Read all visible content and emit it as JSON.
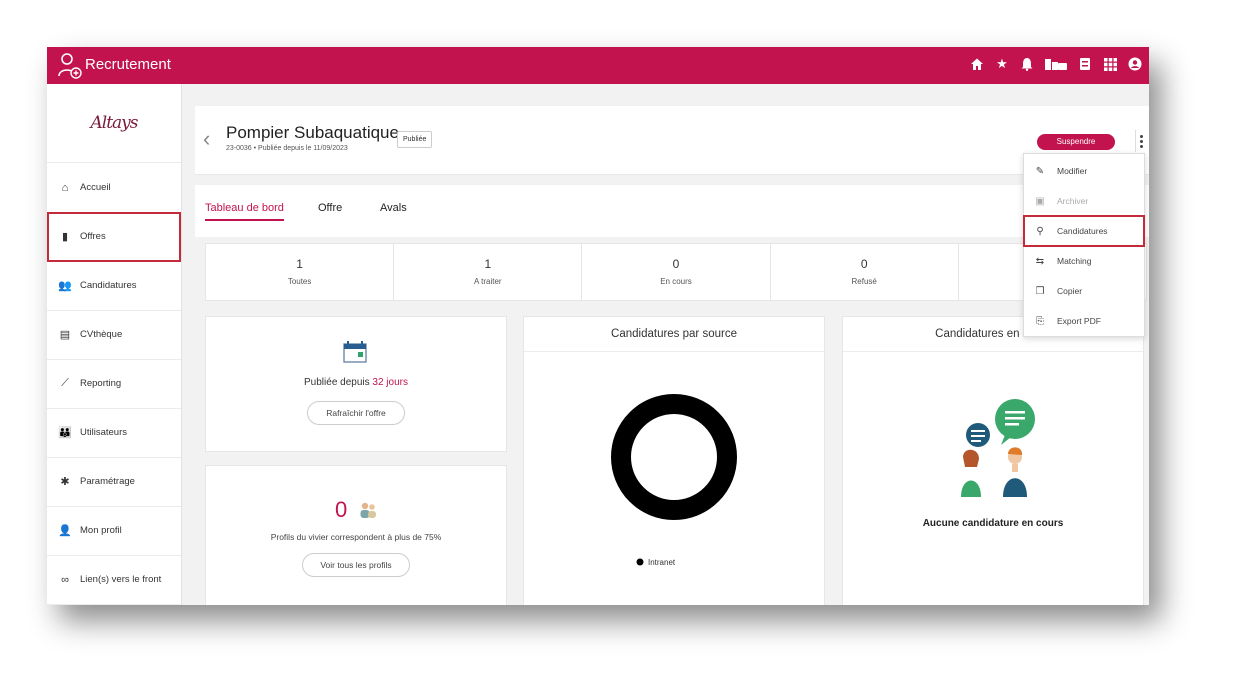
{
  "app": {
    "title": "Recrutement"
  },
  "brand": {
    "logo_text": "Altays"
  },
  "sidebar": {
    "items": [
      {
        "label": "Accueil",
        "icon": "home-icon"
      },
      {
        "label": "Offres",
        "icon": "documents-icon"
      },
      {
        "label": "Candidatures",
        "icon": "users-icon"
      },
      {
        "label": "CVthèque",
        "icon": "file-icon"
      },
      {
        "label": "Reporting",
        "icon": "chart-icon"
      },
      {
        "label": "Utilisateurs",
        "icon": "group-icon"
      },
      {
        "label": "Paramétrage",
        "icon": "gear-icon"
      },
      {
        "label": "Mon profil",
        "icon": "person-icon"
      },
      {
        "label": "Lien(s) vers le front",
        "icon": "link-icon"
      }
    ]
  },
  "header": {
    "title": "Pompier Subaquatique",
    "subtitle": "23-0036 • Publiée depuis le 11/09/2023",
    "status_badge": "Publiée",
    "suspend_label": "Suspendre"
  },
  "tabs": [
    {
      "label": "Tableau de bord"
    },
    {
      "label": "Offre"
    },
    {
      "label": "Avals"
    }
  ],
  "stats": [
    {
      "value": "1",
      "label": "Toutes"
    },
    {
      "value": "1",
      "label": "A traiter"
    },
    {
      "value": "0",
      "label": "En cours"
    },
    {
      "value": "0",
      "label": "Refusé"
    },
    {
      "value": "",
      "label": ""
    }
  ],
  "publish_card": {
    "text_prefix": "Publiée depuis ",
    "days": "32 jours",
    "refresh_button": "Rafraîchir l'offre"
  },
  "profiles_card": {
    "count": "0",
    "text": "Profils du vivier correspondent à plus de 75%",
    "button": "Voir tous les profils"
  },
  "source_card": {
    "title": "Candidatures par source",
    "legend": "Intranet"
  },
  "encours_card": {
    "title": "Candidatures en cours",
    "empty_text": "Aucune candidature en cours"
  },
  "dropdown": {
    "items": [
      {
        "label": "Modifier",
        "icon": "edit-icon"
      },
      {
        "label": "Archiver",
        "icon": "archive-icon"
      },
      {
        "label": "Candidatures",
        "icon": "candidates-icon"
      },
      {
        "label": "Matching",
        "icon": "matching-icon"
      },
      {
        "label": "Copier",
        "icon": "copy-icon"
      },
      {
        "label": "Export PDF",
        "icon": "pdf-icon"
      }
    ]
  },
  "chart_data": {
    "type": "pie",
    "title": "Candidatures par source",
    "categories": [
      "Intranet"
    ],
    "values": [
      1
    ],
    "legend": "bottom"
  },
  "colors": {
    "brand": "#c2134f",
    "highlight": "#c32a3a"
  }
}
